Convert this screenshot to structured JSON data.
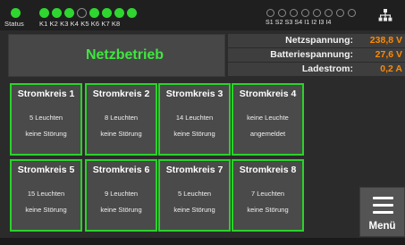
{
  "topbar": {
    "status_label": "Status",
    "relay_label": "K1 K2 K3 K4 K5 K6 K7 K8",
    "input_label": "S1 S2 S3 S4  I1   I2   I3   I4",
    "status_led": "on",
    "relay_leds": [
      "on",
      "on",
      "on",
      "off",
      "on",
      "on",
      "on",
      "on"
    ],
    "input_leds": [
      "off",
      "off",
      "off",
      "off",
      "off",
      "off",
      "off",
      "off"
    ],
    "network_icon": "network-icon"
  },
  "status": {
    "text": "Netzbetrieb"
  },
  "readings": [
    {
      "label": "Netzspannung:",
      "value": "238,8 V"
    },
    {
      "label": "Batteriespannung:",
      "value": "27,6 V"
    },
    {
      "label": "Ladestrom:",
      "value": "0,2 A"
    }
  ],
  "circuits": [
    {
      "title": "Stromkreis 1",
      "line1": "5 Leuchten",
      "line2": "keine Störung"
    },
    {
      "title": "Stromkreis 2",
      "line1": "8 Leuchten",
      "line2": "keine Störung"
    },
    {
      "title": "Stromkreis 3",
      "line1": "14 Leuchten",
      "line2": "keine Störung"
    },
    {
      "title": "Stromkreis 4",
      "line1": "keine Leuchte",
      "line2": "angemeldet"
    },
    {
      "title": "Stromkreis 5",
      "line1": "15 Leuchten",
      "line2": "keine Störung"
    },
    {
      "title": "Stromkreis 6",
      "line1": "9 Leuchten",
      "line2": "keine Störung"
    },
    {
      "title": "Stromkreis 7",
      "line1": "5 Leuchten",
      "line2": "keine Störung"
    },
    {
      "title": "Stromkreis 8",
      "line1": "7 Leuchten",
      "line2": "keine Störung"
    }
  ],
  "menu": {
    "label": "Menü",
    "icon": "hamburger-icon"
  },
  "colors": {
    "ok_green": "#2bd22b",
    "value_orange": "#ff8a00",
    "background": "#2b2b2b"
  }
}
